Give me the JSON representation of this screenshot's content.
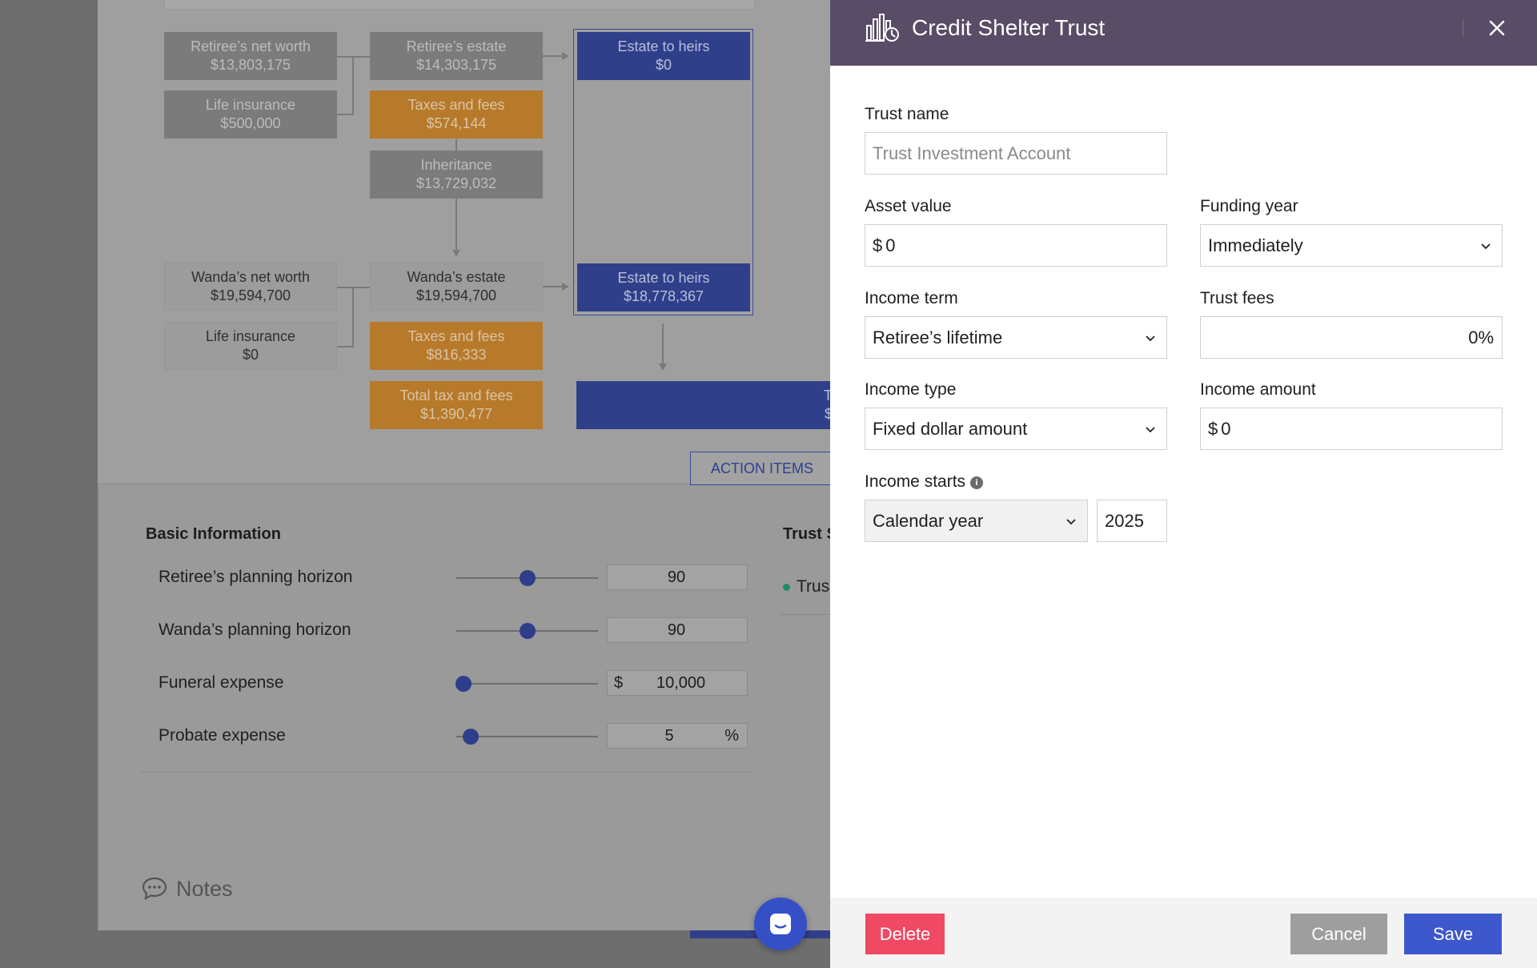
{
  "diagram": {
    "retiree_net_worth": {
      "label": "Retiree’s net worth",
      "value": "$13,803,175"
    },
    "retiree_life_insurance": {
      "label": "Life insurance",
      "value": "$500,000"
    },
    "retiree_estate": {
      "label": "Retiree’s estate",
      "value": "$14,303,175"
    },
    "retiree_taxes": {
      "label": "Taxes and fees",
      "value": "$574,144"
    },
    "inheritance": {
      "label": "Inheritance",
      "value": "$13,729,032"
    },
    "retiree_heirs": {
      "label": "Estate to heirs",
      "value": "$0"
    },
    "wanda_net_worth": {
      "label": "Wanda’s net worth",
      "value": "$19,594,700"
    },
    "wanda_life_insurance": {
      "label": "Life insurance",
      "value": "$0"
    },
    "wanda_estate": {
      "label": "Wanda’s estate",
      "value": "$19,594,700"
    },
    "wanda_taxes": {
      "label": "Taxes and fees",
      "value": "$816,333"
    },
    "total_taxes": {
      "label": "Total tax and fees",
      "value": "$1,390,477"
    },
    "wanda_heirs": {
      "label": "Estate to heirs",
      "value": "$18,778,367"
    },
    "total_box_partial": {
      "label": "T",
      "value": "$"
    },
    "action_items_label": "ACTION ITEMS"
  },
  "basic_info": {
    "title": "Basic Information",
    "rows": [
      {
        "label": "Retiree’s planning horizon",
        "prefix": "",
        "value": "90",
        "suffix": "",
        "slider": 0.5
      },
      {
        "label": "Wanda’s planning horizon",
        "prefix": "",
        "value": "90",
        "suffix": "",
        "slider": 0.5
      },
      {
        "label": "Funeral expense",
        "prefix": "$",
        "value": "10,000",
        "suffix": "",
        "slider": 0.05
      },
      {
        "label": "Probate expense",
        "prefix": "",
        "value": "5",
        "suffix": "%",
        "slider": 0.1
      }
    ]
  },
  "trust_section": {
    "title_partial": "Trust S",
    "item_partial": "Trus"
  },
  "notes_label": "Notes",
  "panel": {
    "title": "Credit Shelter Trust",
    "trust_name": {
      "label": "Trust name",
      "placeholder": "Trust Investment Account"
    },
    "asset_value": {
      "label": "Asset value",
      "prefix": "$",
      "value": "0"
    },
    "funding_year": {
      "label": "Funding year",
      "value": "Immediately"
    },
    "income_term": {
      "label": "Income term",
      "value": "Retiree’s lifetime"
    },
    "trust_fees": {
      "label": "Trust fees",
      "value": "0%"
    },
    "income_type": {
      "label": "Income type",
      "value": "Fixed dollar amount"
    },
    "income_amount": {
      "label": "Income amount",
      "prefix": "$",
      "value": "0"
    },
    "income_starts": {
      "label": "Income starts",
      "basis": "Calendar year",
      "year": "2025"
    },
    "buttons": {
      "delete": "Delete",
      "cancel": "Cancel",
      "save": "Save"
    }
  },
  "colors": {
    "header": "#594c66",
    "save": "#3d58cc",
    "delete": "#ef4963",
    "cancel": "#9e9e9e",
    "diagram_blue": "#2f3f8a",
    "diagram_orange": "#b7792a"
  },
  "icons": [
    "bar-chart-clock-icon",
    "close-icon",
    "chevron-down-icon",
    "info-icon",
    "chat-bubble-icon",
    "messenger-icon"
  ]
}
